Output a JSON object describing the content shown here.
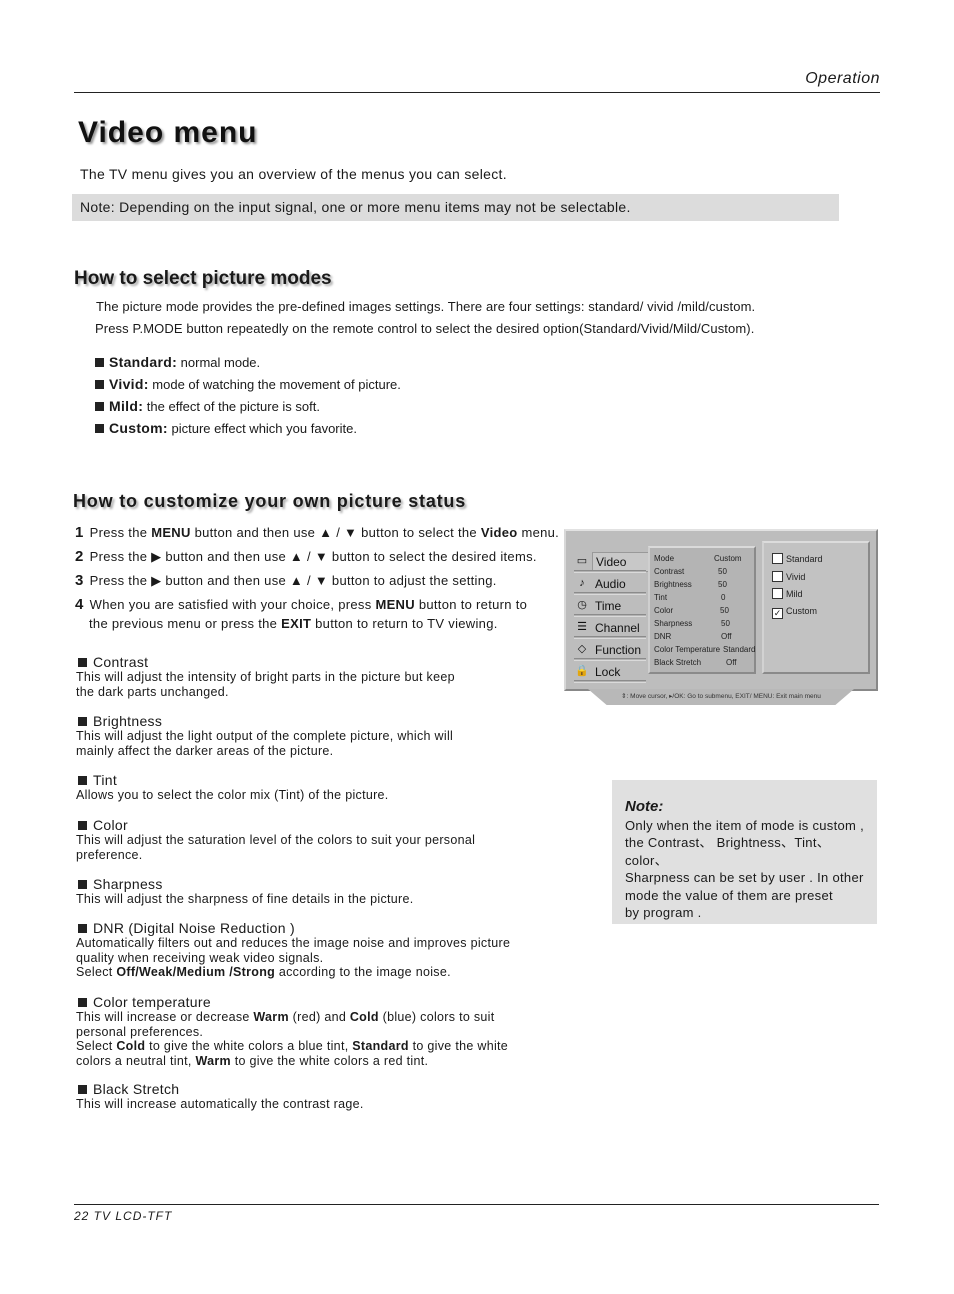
{
  "header": {
    "section_label": "Operation"
  },
  "title": "Video menu",
  "intro": "The TV menu gives you an overview of the menus you can select.",
  "top_note": "Note: Depending on the input signal, one or more menu items may not be selectable.",
  "picture_modes": {
    "heading": "How to select picture modes",
    "para1": "The picture mode provides the pre-defined images settings. There are four settings: standard/ vivid /mild/custom.",
    "para2": "Press  P.MODE button repeatedly on the remote control to select the desired option(Standard/Vivid/Mild/Custom).",
    "modes": [
      {
        "name": "Standard:",
        "desc": "normal mode."
      },
      {
        "name": "Vivid:",
        "desc": "mode of watching the movement of picture."
      },
      {
        "name": "Mild:",
        "desc": "the effect of the picture is soft."
      },
      {
        "name": "Custom:",
        "desc": "picture effect which you favorite."
      }
    ]
  },
  "customize": {
    "heading": "How to customize your own picture status",
    "steps": [
      {
        "num": "1",
        "parts": [
          "Press the ",
          "MENU",
          " button and then use ▲ / ▼ button to select the ",
          "Video",
          " menu."
        ]
      },
      {
        "num": "2",
        "parts": [
          "Press the ▶ button and then use ▲ / ▼ button to select the desired items."
        ]
      },
      {
        "num": "3",
        "parts": [
          "Press the ▶ button and then use ▲ / ▼ button to adjust the setting."
        ]
      },
      {
        "num": "4",
        "parts": [
          "When you are satisfied with your choice,  press ",
          "MENU",
          " button to return to"
        ],
        "line2": [
          "the previous menu or press the ",
          "EXIT",
          " button to return to TV viewing."
        ]
      }
    ]
  },
  "features": [
    {
      "name": "Contrast",
      "lines": [
        "This will adjust the intensity of bright parts in the picture but keep",
        "the dark parts unchanged."
      ]
    },
    {
      "name": "Brightness",
      "lines": [
        "This will adjust the light output of the complete picture, which will",
        "mainly affect the darker areas of the picture."
      ]
    },
    {
      "name": "Tint",
      "lines": [
        "Allows you to select the color mix (Tint) of the picture."
      ]
    },
    {
      "name": "Color",
      "lines": [
        "This will adjust the saturation level of the colors to suit your personal",
        "preference."
      ]
    },
    {
      "name": "Sharpness",
      "lines": [
        "This will adjust the sharpness of fine details in the picture."
      ]
    },
    {
      "name": "DNR (Digital Noise Reduction )",
      "lines": [
        "Automatically filters out and reduces the image noise and improves picture",
        "quality when receiving weak video signals."
      ],
      "select": [
        "Select ",
        "Off/Weak/Medium /Strong",
        " according to the image noise."
      ]
    },
    {
      "name": "Color temperature",
      "rich": [
        [
          "This will increase or decrease ",
          "Warm",
          " (red) and ",
          "Cold",
          " (blue) colors to suit"
        ],
        [
          "personal preferences."
        ],
        [
          "Select ",
          "Cold",
          " to give the white colors a blue tint, ",
          "Standard",
          " to give the white"
        ],
        [
          "colors a neutral tint, ",
          "Warm",
          " to give the white colors a red tint."
        ]
      ]
    },
    {
      "name": "Black Stretch",
      "lines": [
        "This will increase automatically the contrast rage."
      ]
    }
  ],
  "tv_menu": {
    "sidebar": [
      {
        "label": "Video",
        "icon": "monitor-icon",
        "glyph": "▭",
        "active": true
      },
      {
        "label": "Audio",
        "icon": "audio-icon",
        "glyph": "♪",
        "active": false
      },
      {
        "label": "Time",
        "icon": "clock-icon",
        "glyph": "◷",
        "active": false
      },
      {
        "label": "Channel",
        "icon": "channel-icon",
        "glyph": "☰",
        "active": false
      },
      {
        "label": "Function",
        "icon": "function-icon",
        "glyph": "◇",
        "active": false
      },
      {
        "label": "Lock",
        "icon": "lock-icon",
        "glyph": "🔒",
        "active": false
      }
    ],
    "settings": [
      {
        "label": "Mode",
        "value": "Custom"
      },
      {
        "label": "Contrast",
        "value": "50"
      },
      {
        "label": "Brightness",
        "value": "50"
      },
      {
        "label": "Tint",
        "value": "0"
      },
      {
        "label": "Color",
        "value": "50"
      },
      {
        "label": "Sharpness",
        "value": "50"
      },
      {
        "label": "DNR",
        "value": "Off"
      },
      {
        "label": "Color Temperature",
        "value": "Standard"
      },
      {
        "label": "Black Stretch",
        "value": "Off"
      }
    ],
    "mode_options": [
      {
        "label": "Standard",
        "checked": false
      },
      {
        "label": "Vivid",
        "checked": false
      },
      {
        "label": "Mild",
        "checked": false
      },
      {
        "label": "Custom",
        "checked": true
      }
    ],
    "footer_hint": "⇕: Move cursor,  ▸/OK: Go to submenu, EXIT/ MENU: Exit main menu"
  },
  "side_note": {
    "title": "Note:",
    "lines": [
      "Only when the item of mode is custom ,",
      "the Contrast、 Brightness、Tint、color、",
      "Sharpness can be set by user . In other",
      "mode the value of them are preset",
      "by program ."
    ]
  },
  "footer": {
    "page": "22  TV LCD-TFT"
  }
}
